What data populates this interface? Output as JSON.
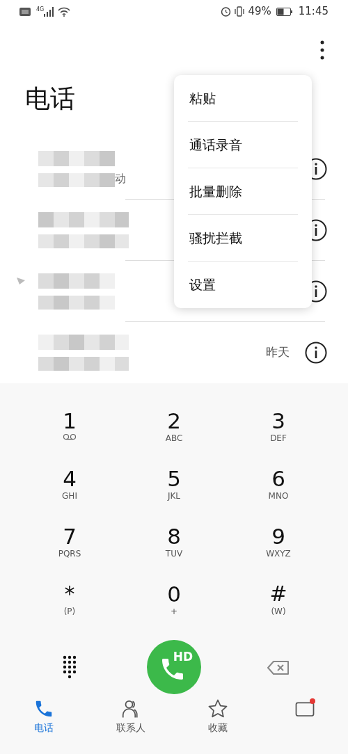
{
  "status_bar": {
    "network": "4G",
    "battery_text": "49%",
    "time": "11:45"
  },
  "title": "电话",
  "calls": [
    {
      "kind": "redacted",
      "visible_text": "动"
    },
    {
      "kind": "redacted"
    },
    {
      "kind": "redacted",
      "missed": true
    },
    {
      "kind": "redacted",
      "time": "昨天"
    }
  ],
  "menu": [
    "粘贴",
    "通话录音",
    "批量删除",
    "骚扰拦截",
    "设置"
  ],
  "keys": [
    {
      "digit": "1",
      "kind": "voicemail"
    },
    {
      "digit": "2",
      "letters": "ABC"
    },
    {
      "digit": "3",
      "letters": "DEF"
    },
    {
      "digit": "4",
      "letters": "GHI"
    },
    {
      "digit": "5",
      "letters": "JKL"
    },
    {
      "digit": "6",
      "letters": "MNO"
    },
    {
      "digit": "7",
      "letters": "PQRS"
    },
    {
      "digit": "8",
      "letters": "TUV"
    },
    {
      "digit": "9",
      "letters": "WXYZ"
    },
    {
      "digit": "*",
      "letters": "(P)"
    },
    {
      "digit": "0",
      "letters": "+"
    },
    {
      "digit": "#",
      "letters": "(W)"
    }
  ],
  "call_button": "HD",
  "nav": [
    {
      "kind": "phone",
      "label": "电话",
      "selected": true
    },
    {
      "kind": "contacts",
      "label": "联系人",
      "selected": false
    },
    {
      "kind": "star",
      "label": "收藏",
      "selected": false
    },
    {
      "kind": "card",
      "selected": false,
      "badge": true
    }
  ]
}
